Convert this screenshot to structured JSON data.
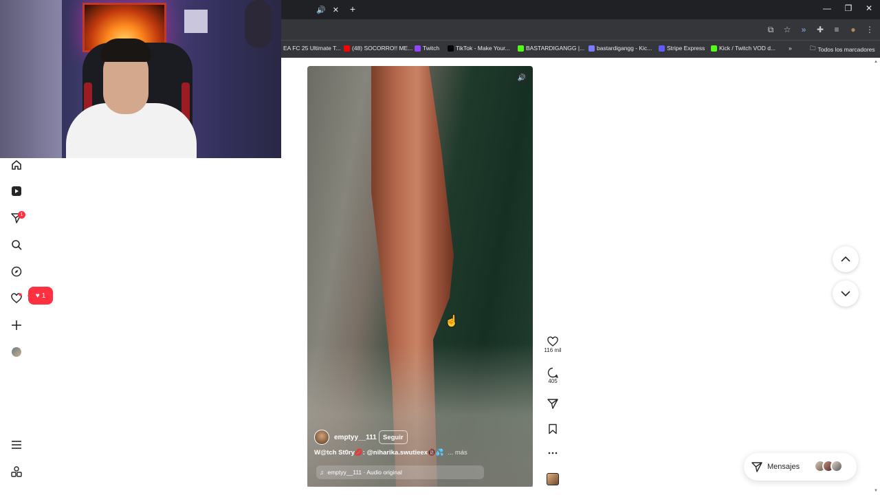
{
  "browser": {
    "tab_controls": {
      "audio": "🔊",
      "close": "✕"
    },
    "new_tab": "+",
    "window": {
      "minimize": "—",
      "restore": "❐",
      "close": "✕"
    },
    "bookmarks": [
      {
        "label": "EA FC 25 Ultimate T...",
        "color": "#ffffff"
      },
      {
        "label": "(48) SOCORRO!! ME...",
        "color": "#ff0000"
      },
      {
        "label": "Twitch",
        "color": "#9146ff"
      },
      {
        "label": "TikTok - Make Your...",
        "color": "#000000"
      },
      {
        "label": "BASTARDIGANGG |...",
        "color": "#53fc18"
      },
      {
        "label": "bastardigangg - Kic...",
        "color": "#7b7bff"
      },
      {
        "label": "Stripe Express",
        "color": "#635bff"
      },
      {
        "label": "Kick / Twitch VOD d...",
        "color": "#53fc18"
      }
    ],
    "bookmarks_overflow": "»",
    "all_bookmarks": "Todos los marcadores"
  },
  "nav": {
    "messages_badge": "1",
    "notifications_count": "1"
  },
  "reel": {
    "username": "emptyy__111",
    "follow_label": "Seguir",
    "caption": "W@tch St0ry💋: @niharika.swutieex🔞💦",
    "caption_more": "... más",
    "audio": "emptyy__111 · Audio original",
    "likes": "116 mil",
    "comments": "405"
  },
  "messages": {
    "label": "Mensajes"
  }
}
